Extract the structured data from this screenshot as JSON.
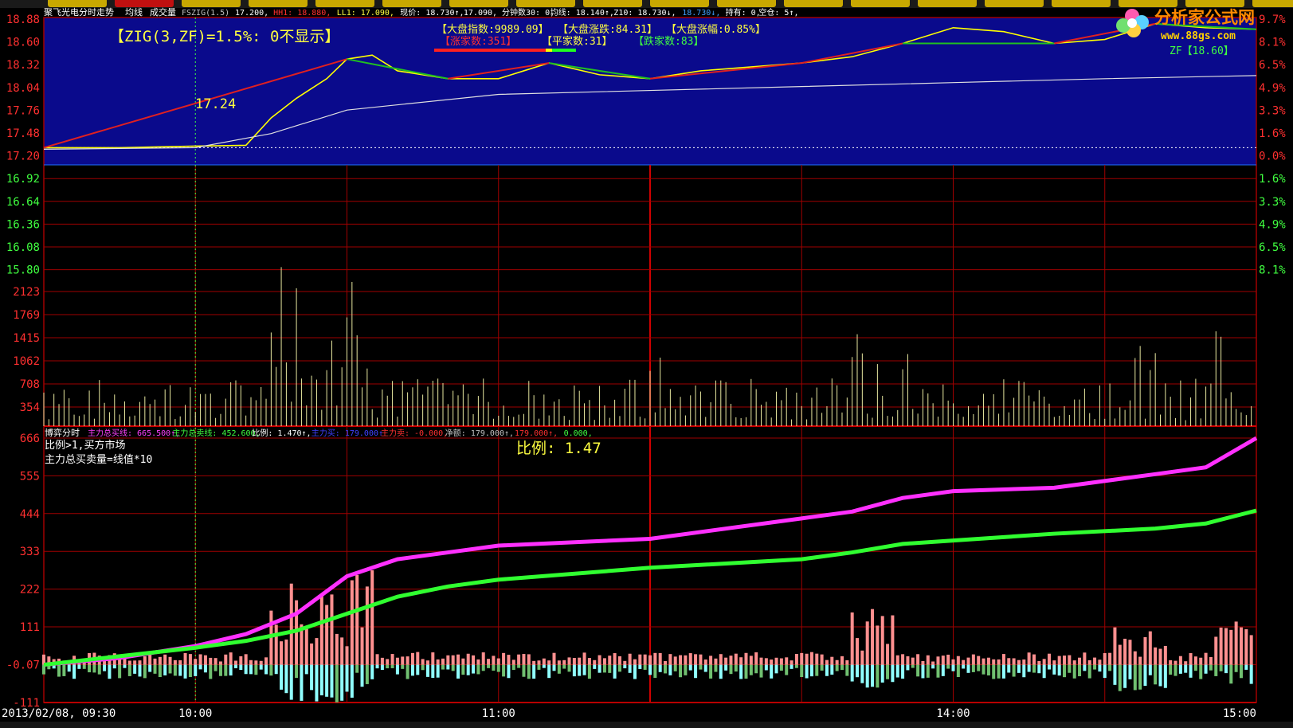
{
  "header": {
    "stock_name": "聚飞光电分时走势",
    "indicator_labels": [
      "均线",
      "成交量"
    ],
    "readouts": [
      {
        "text": "FSZIG(1.5)",
        "color": "#c0c0c0"
      },
      {
        "text": "17.200,",
        "color": "#ffffff"
      },
      {
        "text": "HH1: 18.880,",
        "color": "#ff3030"
      },
      {
        "text": "LL1: 17.090,",
        "color": "#ffff40"
      },
      {
        "text": "现价: 18.730↑,",
        "color": "#ffffff"
      },
      {
        "text": "17.090,",
        "color": "#ffffff"
      },
      {
        "text": "分钟数30: 0,",
        "color": "#ffffff"
      },
      {
        "text": "均线: 18.140↑,",
        "color": "#ffffff"
      },
      {
        "text": "Z10: 18.730↓,",
        "color": "#ffffff"
      },
      {
        "text": "18.730↓,",
        "color": "#3fa0ff"
      },
      {
        "text": "持有: 0,",
        "color": "#ffffff"
      },
      {
        "text": "空仓: 5↑,",
        "color": "#ffffff"
      }
    ]
  },
  "market": {
    "index": "【大盘指数:9989.09】",
    "change": "【大盘涨跌:84.31】",
    "pct": "【大盘涨幅:0.85%】",
    "up": "【涨家数:351】",
    "flat": "【平家数:31】",
    "down": "【跌家数:83】"
  },
  "price_panel": {
    "zig_note": "【ZIG(3,ZF)=1.5%:  0不显示】",
    "low_label": "17.24",
    "zf_label": "ZF【18.60】",
    "price_ticks": [
      "18.88",
      "18.60",
      "18.32",
      "18.04",
      "17.76",
      "17.48",
      "17.20",
      "16.92",
      "16.64",
      "16.36",
      "16.08",
      "15.80"
    ],
    "pct_ticks_up": [
      "9.7%",
      "8.1%",
      "6.5%",
      "4.9%",
      "3.3%",
      "1.6%",
      "0.0%"
    ],
    "pct_ticks_down": [
      "1.6%",
      "3.3%",
      "4.9%",
      "6.5%",
      "8.1%"
    ]
  },
  "volume_panel": {
    "ticks": [
      "2123",
      "1769",
      "1415",
      "1062",
      "708",
      "354"
    ]
  },
  "flow_panel": {
    "title": "博弈分时",
    "readouts": [
      {
        "text": "主力总买线: 665.500↑,",
        "color": "#ff40ff"
      },
      {
        "text": "主力总卖线: 452.600,",
        "color": "#40ff40"
      },
      {
        "text": "比例: 1.470↑,",
        "color": "#ffffff"
      },
      {
        "text": "主力买: 179.000↑",
        "color": "#4040ff"
      },
      {
        "text": "主力卖: -0.000,",
        "color": "#ff3030"
      },
      {
        "text": "净额: 179.000↑,",
        "color": "#c0c0c0"
      },
      {
        "text": "179.000↑,",
        "color": "#ff3030"
      },
      {
        "text": "0.000,",
        "color": "#40ff40"
      }
    ],
    "note1": "比例>1,买方市场",
    "note2": "主力总买卖量=线值*10",
    "ratio_label": "比例: 1.47",
    "ticks": [
      "666",
      "555",
      "444",
      "333",
      "222",
      "111",
      "-0.07",
      "-111"
    ]
  },
  "time_axis": {
    "labels": [
      "2013/02/08, 09:30",
      "10:00",
      "11:00",
      "14:00",
      "15:00"
    ]
  },
  "logo": {
    "name": "分析家公式网",
    "url": "www.88gs.com"
  },
  "colors": {
    "price_bg": "#0a0a8c",
    "grid": "#a00000",
    "price_line": "#ffff00",
    "avg_line": "#e0e0e0",
    "zig_up": "#e02020",
    "zig_down": "#20c020",
    "buy_line": "#ff30ff",
    "sell_line": "#30ff30"
  },
  "chart_data": [
    {
      "type": "line",
      "title": "",
      "x_range": [
        "09:30",
        "15:00"
      ],
      "ylim": [
        15.66,
        18.88
      ],
      "series": [
        {
          "name": "",
          "x": [
            "09:30",
            "09:45",
            "10:00",
            "10:10",
            "10:15",
            "10:20",
            "10:26",
            "10:30",
            "10:35",
            "10:40",
            "10:50",
            "11:00",
            "11:05",
            "11:10",
            "11:20",
            "11:30",
            "13:10",
            "13:30",
            "13:40",
            "13:50",
            "14:00",
            "14:10",
            "14:20",
            "14:30",
            "14:40",
            "14:50",
            "15:00"
          ],
          "values": [
            17.22,
            17.22,
            17.24,
            17.25,
            17.6,
            17.85,
            18.1,
            18.35,
            18.4,
            18.2,
            18.1,
            18.1,
            18.2,
            18.3,
            18.15,
            18.1,
            18.2,
            18.3,
            18.38,
            18.55,
            18.75,
            18.7,
            18.55,
            18.6,
            18.8,
            18.75,
            18.73
          ]
        },
        {
          "name": "",
          "x": [
            "09:30",
            "10:00",
            "10:15",
            "10:30",
            "11:00",
            "11:30",
            "13:30",
            "14:00",
            "14:30",
            "15:00"
          ],
          "values": [
            17.2,
            17.22,
            17.4,
            17.7,
            17.9,
            17.95,
            18.0,
            18.05,
            18.1,
            18.14
          ]
        }
      ]
    },
    {
      "type": "line",
      "title": "",
      "ylim": [
        -111,
        666
      ],
      "series": [
        {
          "name": "主力总买线",
          "x": [
            "09:30",
            "09:45",
            "10:00",
            "10:10",
            "10:20",
            "10:30",
            "10:40",
            "10:50",
            "11:00",
            "11:30",
            "13:30",
            "13:40",
            "13:50",
            "14:00",
            "14:20",
            "14:40",
            "14:50",
            "15:00"
          ],
          "values": [
            0,
            20,
            55,
            90,
            150,
            260,
            310,
            330,
            350,
            370,
            430,
            450,
            490,
            510,
            520,
            560,
            580,
            666
          ]
        },
        {
          "name": "主力总卖线",
          "x": [
            "09:30",
            "09:45",
            "10:00",
            "10:10",
            "10:20",
            "10:30",
            "10:40",
            "10:50",
            "11:00",
            "11:30",
            "13:30",
            "13:40",
            "13:50",
            "14:00",
            "14:20",
            "14:40",
            "14:50",
            "15:00"
          ],
          "values": [
            0,
            25,
            50,
            70,
            100,
            150,
            200,
            230,
            250,
            285,
            310,
            330,
            355,
            365,
            385,
            400,
            415,
            453
          ]
        }
      ]
    }
  ]
}
